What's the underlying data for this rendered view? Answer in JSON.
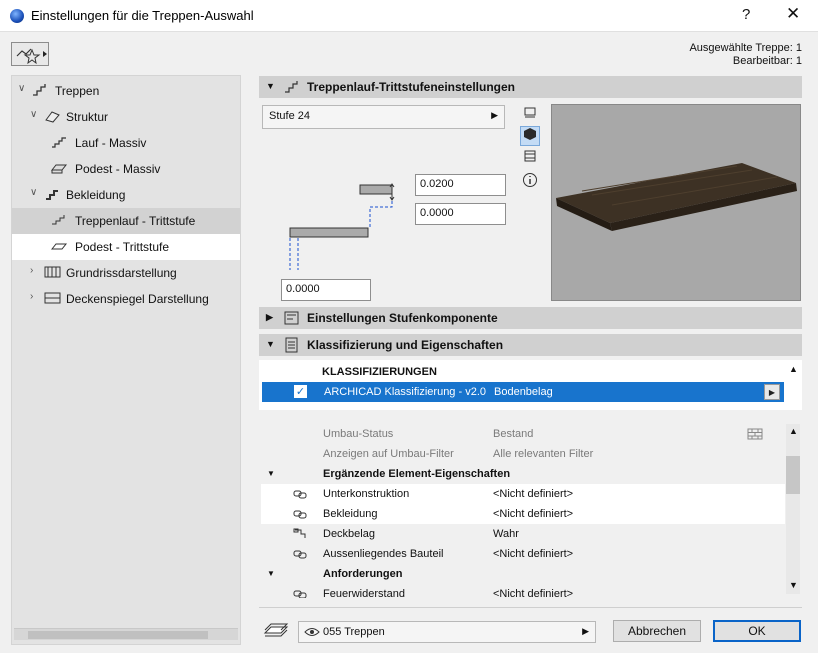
{
  "window": {
    "title": "Einstellungen für die Treppen-Auswahl",
    "help": "?",
    "close": "✕"
  },
  "selection": {
    "line1": "Ausgewählte Treppe: 1",
    "line2": "Bearbeitbar: 1"
  },
  "tree": {
    "items": [
      {
        "label": "Treppen",
        "arrow": "∨"
      },
      {
        "label": "Struktur",
        "arrow": "∨"
      },
      {
        "label": "Lauf - Massiv"
      },
      {
        "label": "Podest - Massiv"
      },
      {
        "label": "Bekleidung",
        "arrow": "∨"
      },
      {
        "label": "Treppenlauf - Trittstufe"
      },
      {
        "label": "Podest - Trittstufe"
      },
      {
        "label": "Grundrissdarstellung",
        "arrow": "›"
      },
      {
        "label": "Deckenspiegel Darstellung",
        "arrow": "›"
      }
    ]
  },
  "sections": {
    "tread": {
      "title": "Treppenlauf-Trittstufeneinstellungen"
    },
    "components": {
      "title": "Einstellungen Stufenkomponente"
    },
    "classification": {
      "title": "Klassifizierung und Eigenschaften"
    }
  },
  "tread": {
    "profile": "Stufe 24",
    "thickness": "0.0200",
    "offset": "0.0000",
    "bottom": "0.0000"
  },
  "classifications": {
    "header": "KLASSIFIZIERUNGEN",
    "system": "ARCHICAD Klassifizierung - v2.0",
    "value": "Bodenbelag"
  },
  "properties": {
    "rows": [
      {
        "name": "Umbau-Status",
        "value": "Bestand"
      },
      {
        "name": "Anzeigen auf Umbau-Filter",
        "value": "Alle relevanten Filter"
      },
      {
        "name": "Ergänzende Element-Eigenschaften",
        "value": ""
      },
      {
        "name": "Unterkonstruktion",
        "value": "<Nicht definiert>"
      },
      {
        "name": "Bekleidung",
        "value": "<Nicht definiert>"
      },
      {
        "name": "Deckbelag",
        "value": "Wahr"
      },
      {
        "name": "Aussenliegendes Bauteil",
        "value": "<Nicht definiert>"
      },
      {
        "name": "Anforderungen",
        "value": ""
      },
      {
        "name": "Feuerwiderstand",
        "value": "<Nicht definiert>"
      }
    ]
  },
  "footer": {
    "layer": "055 Treppen",
    "cancel": "Abbrechen",
    "ok": "OK"
  },
  "colors": {
    "selection": "#1874cd",
    "accent": "#0a64c8"
  }
}
